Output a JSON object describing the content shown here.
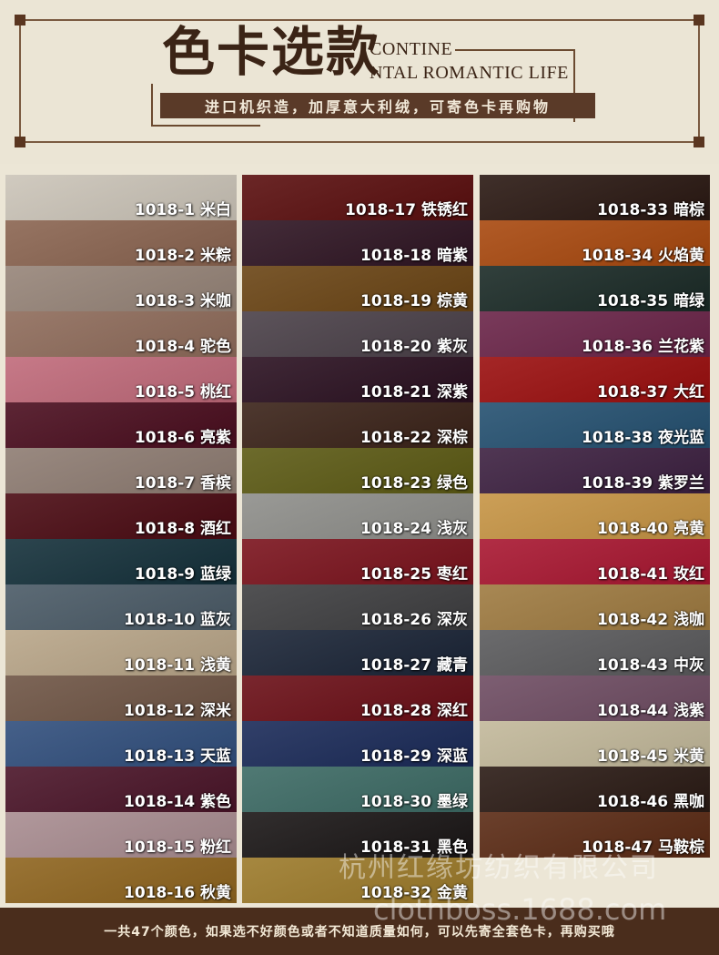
{
  "header": {
    "title_cn": "色卡选款",
    "title_en_line1": "CONTINE",
    "title_en_line2": "NTAL ROMANTIC LIFE",
    "subtitle": "进口机织造，加厚意大利绒，可寄色卡再购物"
  },
  "columns": [
    [
      {
        "label": "1018-1 米白",
        "color": "#cbc4b8"
      },
      {
        "label": "1018-2 米粽",
        "color": "#8a6450"
      },
      {
        "label": "1018-3 米咖",
        "color": "#968478"
      },
      {
        "label": "1018-4 驼色",
        "color": "#8e6b5a"
      },
      {
        "label": "1018-5 桃红",
        "color": "#c06a7a"
      },
      {
        "label": "1018-6 亮紫",
        "color": "#4a0d1e"
      },
      {
        "label": "1018-7 香槟",
        "color": "#8e7c72"
      },
      {
        "label": "1018-8 酒红",
        "color": "#4a0a12"
      },
      {
        "label": "1018-9 蓝绿",
        "color": "#14303a"
      },
      {
        "label": "1018-10 蓝灰",
        "color": "#4a5a66"
      },
      {
        "label": "1018-11 浅黄",
        "color": "#b8a588"
      },
      {
        "label": "1018-12 深米",
        "color": "#6e5444"
      },
      {
        "label": "1018-13 天蓝",
        "color": "#304e7c"
      },
      {
        "label": "1018-14 紫色",
        "color": "#4a1428"
      },
      {
        "label": "1018-15 粉红",
        "color": "#a88c90"
      },
      {
        "label": "1018-16 秋黄",
        "color": "#8e641e"
      }
    ],
    [
      {
        "label": "1018-17 铁锈红",
        "color": "#5a0e0e"
      },
      {
        "label": "1018-18 暗紫",
        "color": "#2e1422"
      },
      {
        "label": "1018-19 棕黄",
        "color": "#6a4414"
      },
      {
        "label": "1018-20 紫灰",
        "color": "#4a4048"
      },
      {
        "label": "1018-21 深紫",
        "color": "#2a1020"
      },
      {
        "label": "1018-22 深棕",
        "color": "#3a2218"
      },
      {
        "label": "1018-23 绿色",
        "color": "#5c5a14"
      },
      {
        "label": "1018-24 浅灰",
        "color": "#8e8e8a"
      },
      {
        "label": "1018-25 枣红",
        "color": "#7a121c"
      },
      {
        "label": "1018-26 深灰",
        "color": "#3e3e40"
      },
      {
        "label": "1018-27 藏青",
        "color": "#1a2436"
      },
      {
        "label": "1018-28 深红",
        "color": "#6a0e16"
      },
      {
        "label": "1018-29 深蓝",
        "color": "#1a2a58"
      },
      {
        "label": "1018-30 墨绿",
        "color": "#3c6a64"
      },
      {
        "label": "1018-31 黑色",
        "color": "#1a1616"
      },
      {
        "label": "1018-32 金黄",
        "color": "#9c7a2a"
      }
    ],
    [
      {
        "label": "1018-33 暗棕",
        "color": "#2a1812"
      },
      {
        "label": "1018-34 火焰黄",
        "color": "#a8480e"
      },
      {
        "label": "1018-35 暗绿",
        "color": "#1a2a26"
      },
      {
        "label": "1018-36 兰花紫",
        "color": "#6a2448"
      },
      {
        "label": "1018-37 大红",
        "color": "#9a0e0e"
      },
      {
        "label": "1018-38 夜光蓝",
        "color": "#245070"
      },
      {
        "label": "1018-39 紫罗兰",
        "color": "#3c2040"
      },
      {
        "label": "1018-40 亮黄",
        "color": "#c69444"
      },
      {
        "label": "1018-41 玫红",
        "color": "#a81630"
      },
      {
        "label": "1018-42 浅咖",
        "color": "#9e7a40"
      },
      {
        "label": "1018-43 中灰",
        "color": "#5a5a5c"
      },
      {
        "label": "1018-44 浅紫",
        "color": "#6e4c62"
      },
      {
        "label": "1018-45 米黄",
        "color": "#c2b89a"
      },
      {
        "label": "1018-46 黑咖",
        "color": "#2a1a14"
      },
      {
        "label": "1018-47 马鞍棕",
        "color": "#5a2a14"
      }
    ]
  ],
  "footer": {
    "text": "一共47个颜色，如果选不好颜色或者不知道质量如何，可以先寄全套色卡，再购买哦"
  },
  "watermark": {
    "line1": "杭州红缘坊纺织有限公司",
    "line2": "clothboss.1688.com"
  }
}
